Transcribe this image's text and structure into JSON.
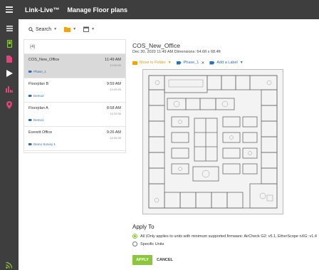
{
  "header": {
    "brand": "Link-Live™",
    "title": "Manage Floor plans"
  },
  "rail": {
    "items": [
      "menu-icon",
      "phone-icon",
      "document-icon",
      "play-icon",
      "analytics-icon",
      "location-pin-icon",
      "wifi-icon"
    ],
    "colors": {
      "phone": "#8cc63f",
      "document": "#e0457b",
      "play": "#ffffff",
      "analytics": "#e0457b",
      "pin": "#e0457b",
      "wifi": "#8cc63f"
    }
  },
  "toolbar": {
    "search_label": "Search"
  },
  "list": {
    "count": "(4)",
    "rows": [
      {
        "name": "COS_New_Office",
        "time": "11:49 AM",
        "time2": "12:00:00",
        "label": "Phase_1",
        "selected": true
      },
      {
        "name": "Floorplan B",
        "time": "9:59 AM",
        "time2": "12:29:20",
        "label": "Demo2",
        "selected": false
      },
      {
        "name": "Floorplan A",
        "time": "8:58 AM",
        "time2": "12:29:30",
        "label": "Demo1",
        "selected": false
      },
      {
        "name": "Everett Office",
        "time": "9:26 AM",
        "time2": "12:00:30",
        "label": "Demo Survey 1",
        "selected": false
      }
    ]
  },
  "detail": {
    "title": "COS_New_Office",
    "meta": "Dec 30, 2020 11:49 AM Dimensions: 64.6ft x 68.4ft",
    "move_to_folder": "Move to Folder",
    "label_chip": "Phase_1",
    "add_label": "Add a Label"
  },
  "apply": {
    "heading": "Apply To",
    "option_all": "All (Only applies to units with minimum supported firmware: AirCheck G2: v5.1, EtherScope nXG: v1.4",
    "option_specific": "Specific Units",
    "apply_button": "APPLY",
    "cancel_button": "CANCEL"
  },
  "colors": {
    "accent_green": "#8cc63f",
    "folder_orange": "#e59a0c",
    "label_blue": "#2f6fb0",
    "topbar": "#3e3e3e"
  }
}
